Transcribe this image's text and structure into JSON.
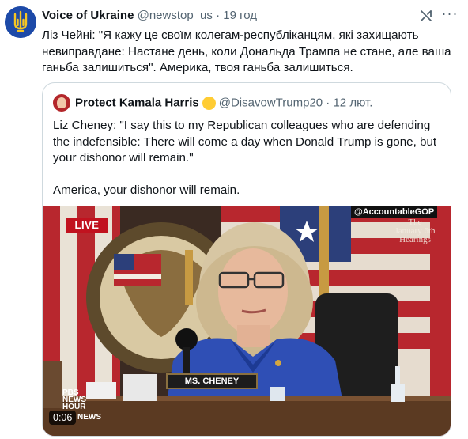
{
  "post": {
    "author_name": "Voice of Ukraine",
    "author_handle": "@newstop_us",
    "separator": "·",
    "time": "19 год",
    "avatar_icon": "trident-icon",
    "text": "Ліз Чейні: \"Я кажу це своїм колегам-республіканцям, які захищають невиправдане: Настане день, коли Дональда Трампа не стане, але ваша ганьба залишиться\".   Америка, твоя ганьба залишиться."
  },
  "quote": {
    "author_name": "Protect Kamala Harris",
    "author_handle": "@DisavowTrump20",
    "separator": "·",
    "time": "12 лют.",
    "paragraph_1": "Liz Cheney: \"I say this to my Republican colleagues who are defending the indefensible: There will come a day when Donald Trump is gone, but your dishonor will remain.\"",
    "paragraph_2": "America, your dishonor will remain."
  },
  "video": {
    "live_label": "LIVE",
    "watermark_handle": "@AccountableGOP",
    "watermark_title_1": "The",
    "watermark_title_2": "January 6th",
    "watermark_title_3": "Hearings",
    "nameplate": "MS. CHENEY",
    "logo_line_1": "PBS",
    "logo_line_2": "NEWS",
    "logo_line_3": "HOUR",
    "timestamp": "0:06",
    "logo_small": "NEWS"
  },
  "colors": {
    "text_primary": "#0f1419",
    "text_secondary": "#536471",
    "border": "#cfd9de",
    "live_red": "#c1121f",
    "suit_blue": "#2f4fb5"
  }
}
